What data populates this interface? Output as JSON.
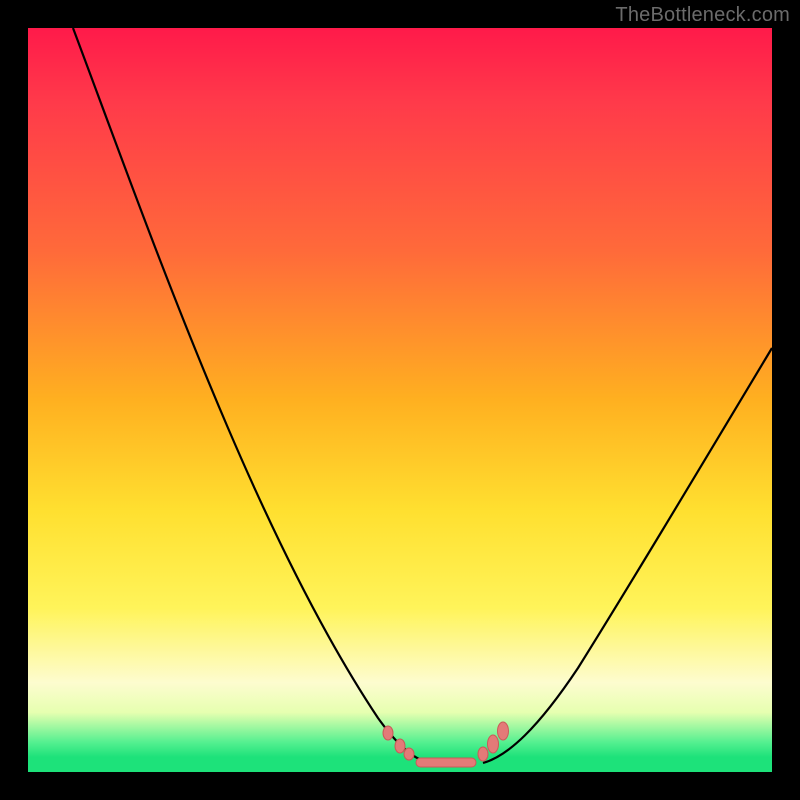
{
  "watermark": "TheBottleneck.com",
  "colors": {
    "background": "#000000",
    "gradient_top": "#ff1a4a",
    "gradient_mid1": "#ff6a3a",
    "gradient_mid2": "#ffe030",
    "gradient_mid3": "#fdfccf",
    "gradient_bottom": "#1de27a",
    "curve_stroke": "#000000",
    "marker_fill": "#e37a78",
    "marker_stroke": "#c95a58"
  },
  "chart_data": {
    "type": "line",
    "title": "",
    "xlabel": "",
    "ylabel": "",
    "xlim": [
      0,
      100
    ],
    "ylim": [
      0,
      100
    ],
    "grid": false,
    "legend": false,
    "annotations": [
      "TheBottleneck.com"
    ],
    "series": [
      {
        "name": "left-curve",
        "x": [
          6,
          10,
          15,
          20,
          25,
          30,
          35,
          40,
          44,
          47,
          49.5,
          51,
          52.5
        ],
        "values": [
          100,
          90,
          78,
          66,
          54,
          43,
          33,
          23,
          15,
          9,
          5,
          3,
          2
        ]
      },
      {
        "name": "right-curve",
        "x": [
          61,
          63,
          66,
          70,
          75,
          80,
          85,
          90,
          95,
          100
        ],
        "values": [
          2,
          3.5,
          6,
          10,
          16,
          23,
          31,
          39,
          48,
          57
        ]
      },
      {
        "name": "trough-markers",
        "x": [
          50,
          51.5,
          53,
          54.5,
          56,
          57.5,
          59,
          60.5,
          62,
          63
        ],
        "values": [
          4,
          3,
          2,
          1.5,
          1.5,
          1.5,
          1.5,
          2,
          3.5,
          5
        ]
      }
    ]
  }
}
